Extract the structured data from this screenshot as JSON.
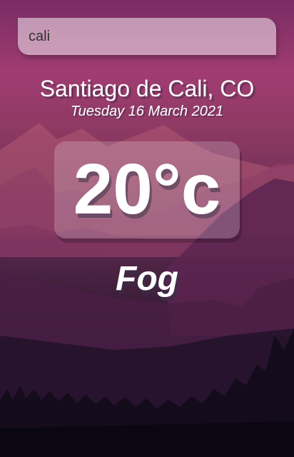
{
  "search": {
    "value": "cali"
  },
  "location": {
    "label": "Santiago de Cali, CO"
  },
  "date": {
    "label": "Tuesday 16 March 2021"
  },
  "weather": {
    "temperature": "20°c",
    "condition": "Fog"
  },
  "colors": {
    "sky_top": "#7a2c64",
    "sky_mid": "#a03c72",
    "ground_bottom": "#110a17",
    "text": "#ffffff"
  }
}
